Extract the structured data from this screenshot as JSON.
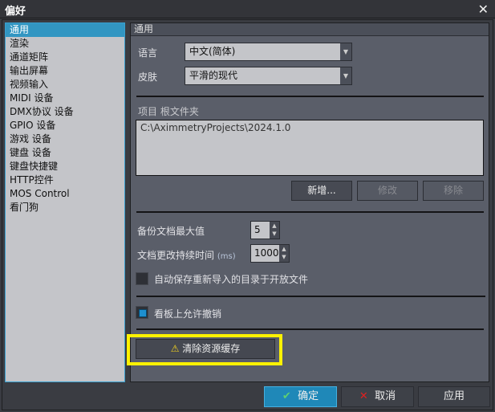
{
  "window": {
    "title": "偏好",
    "close_icon": "close-icon"
  },
  "sidebar": {
    "items": [
      {
        "label": "通用",
        "selected": true
      },
      {
        "label": "渲染"
      },
      {
        "label": "通道矩阵"
      },
      {
        "label": "输出屏幕"
      },
      {
        "label": "视频输入"
      },
      {
        "label": "MIDI 设备"
      },
      {
        "label": "DMX协议 设备"
      },
      {
        "label": "GPIO 设备"
      },
      {
        "label": "游戏 设备"
      },
      {
        "label": "键盘 设备"
      },
      {
        "label": "键盘快捷键"
      },
      {
        "label": "HTTP控件"
      },
      {
        "label": "MOS Control"
      },
      {
        "label": "看门狗"
      }
    ]
  },
  "panel": {
    "header": "通用",
    "language": {
      "label": "语言",
      "value": "中文(简体)"
    },
    "skin": {
      "label": "皮肤",
      "value": "平滑的现代"
    },
    "project_root": {
      "label": "项目 根文件夹",
      "paths": [
        "C:\\AximmetryProjects\\2024.1.0"
      ],
      "add": "新增...",
      "modify": "修改",
      "remove": "移除"
    },
    "backup_max": {
      "label": "备份文档最大值",
      "value": "5"
    },
    "doc_change": {
      "label": "文档更改持续时间",
      "unit": "(ms)",
      "value": "1000"
    },
    "autosave": {
      "label": "自动保存重新导入的目录于开放文件",
      "checked": false
    },
    "undo": {
      "label": "看板上允许撤销",
      "checked": true
    },
    "clear_cache": {
      "label": "清除资源缓存",
      "icon": "warning-icon"
    }
  },
  "footer": {
    "ok": "确定",
    "cancel": "取消",
    "apply": "应用"
  },
  "colors": {
    "accent": "#3296c2",
    "highlight": "#fff200"
  }
}
